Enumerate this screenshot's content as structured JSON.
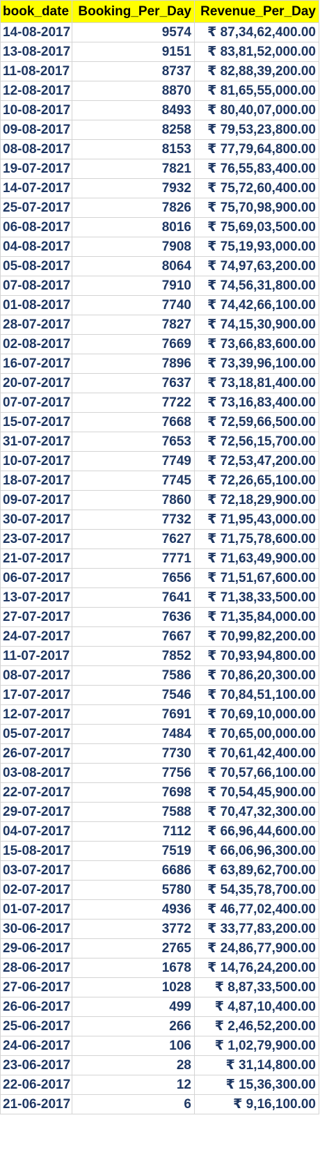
{
  "headers": {
    "date": "book_date",
    "bookings": "Booking_Per_Day",
    "revenue": "Revenue_Per_Day"
  },
  "rows": [
    {
      "date": "14-08-2017",
      "bookings": "9574",
      "revenue": "₹ 87,34,62,400.00"
    },
    {
      "date": "13-08-2017",
      "bookings": "9151",
      "revenue": "₹ 83,81,52,000.00"
    },
    {
      "date": "11-08-2017",
      "bookings": "8737",
      "revenue": "₹ 82,88,39,200.00"
    },
    {
      "date": "12-08-2017",
      "bookings": "8870",
      "revenue": "₹ 81,65,55,000.00"
    },
    {
      "date": "10-08-2017",
      "bookings": "8493",
      "revenue": "₹ 80,40,07,000.00"
    },
    {
      "date": "09-08-2017",
      "bookings": "8258",
      "revenue": "₹ 79,53,23,800.00"
    },
    {
      "date": "08-08-2017",
      "bookings": "8153",
      "revenue": "₹ 77,79,64,800.00"
    },
    {
      "date": "19-07-2017",
      "bookings": "7821",
      "revenue": "₹ 76,55,83,400.00"
    },
    {
      "date": "14-07-2017",
      "bookings": "7932",
      "revenue": "₹ 75,72,60,400.00"
    },
    {
      "date": "25-07-2017",
      "bookings": "7826",
      "revenue": "₹ 75,70,98,900.00"
    },
    {
      "date": "06-08-2017",
      "bookings": "8016",
      "revenue": "₹ 75,69,03,500.00"
    },
    {
      "date": "04-08-2017",
      "bookings": "7908",
      "revenue": "₹ 75,19,93,000.00"
    },
    {
      "date": "05-08-2017",
      "bookings": "8064",
      "revenue": "₹ 74,97,63,200.00"
    },
    {
      "date": "07-08-2017",
      "bookings": "7910",
      "revenue": "₹ 74,56,31,800.00"
    },
    {
      "date": "01-08-2017",
      "bookings": "7740",
      "revenue": "₹ 74,42,66,100.00"
    },
    {
      "date": "28-07-2017",
      "bookings": "7827",
      "revenue": "₹ 74,15,30,900.00"
    },
    {
      "date": "02-08-2017",
      "bookings": "7669",
      "revenue": "₹ 73,66,83,600.00"
    },
    {
      "date": "16-07-2017",
      "bookings": "7896",
      "revenue": "₹ 73,39,96,100.00"
    },
    {
      "date": "20-07-2017",
      "bookings": "7637",
      "revenue": "₹ 73,18,81,400.00"
    },
    {
      "date": "07-07-2017",
      "bookings": "7722",
      "revenue": "₹ 73,16,83,400.00"
    },
    {
      "date": "15-07-2017",
      "bookings": "7668",
      "revenue": "₹ 72,59,66,500.00"
    },
    {
      "date": "31-07-2017",
      "bookings": "7653",
      "revenue": "₹ 72,56,15,700.00"
    },
    {
      "date": "10-07-2017",
      "bookings": "7749",
      "revenue": "₹ 72,53,47,200.00"
    },
    {
      "date": "18-07-2017",
      "bookings": "7745",
      "revenue": "₹ 72,26,65,100.00"
    },
    {
      "date": "09-07-2017",
      "bookings": "7860",
      "revenue": "₹ 72,18,29,900.00"
    },
    {
      "date": "30-07-2017",
      "bookings": "7732",
      "revenue": "₹ 71,95,43,000.00"
    },
    {
      "date": "23-07-2017",
      "bookings": "7627",
      "revenue": "₹ 71,75,78,600.00"
    },
    {
      "date": "21-07-2017",
      "bookings": "7771",
      "revenue": "₹ 71,63,49,900.00"
    },
    {
      "date": "06-07-2017",
      "bookings": "7656",
      "revenue": "₹ 71,51,67,600.00"
    },
    {
      "date": "13-07-2017",
      "bookings": "7641",
      "revenue": "₹ 71,38,33,500.00"
    },
    {
      "date": "27-07-2017",
      "bookings": "7636",
      "revenue": "₹ 71,35,84,000.00"
    },
    {
      "date": "24-07-2017",
      "bookings": "7667",
      "revenue": "₹ 70,99,82,200.00"
    },
    {
      "date": "11-07-2017",
      "bookings": "7852",
      "revenue": "₹ 70,93,94,800.00"
    },
    {
      "date": "08-07-2017",
      "bookings": "7586",
      "revenue": "₹ 70,86,20,300.00"
    },
    {
      "date": "17-07-2017",
      "bookings": "7546",
      "revenue": "₹ 70,84,51,100.00"
    },
    {
      "date": "12-07-2017",
      "bookings": "7691",
      "revenue": "₹ 70,69,10,000.00"
    },
    {
      "date": "05-07-2017",
      "bookings": "7484",
      "revenue": "₹ 70,65,00,000.00"
    },
    {
      "date": "26-07-2017",
      "bookings": "7730",
      "revenue": "₹ 70,61,42,400.00"
    },
    {
      "date": "03-08-2017",
      "bookings": "7756",
      "revenue": "₹ 70,57,66,100.00"
    },
    {
      "date": "22-07-2017",
      "bookings": "7698",
      "revenue": "₹ 70,54,45,900.00"
    },
    {
      "date": "29-07-2017",
      "bookings": "7588",
      "revenue": "₹ 70,47,32,300.00"
    },
    {
      "date": "04-07-2017",
      "bookings": "7112",
      "revenue": "₹ 66,96,44,600.00"
    },
    {
      "date": "15-08-2017",
      "bookings": "7519",
      "revenue": "₹ 66,06,96,300.00"
    },
    {
      "date": "03-07-2017",
      "bookings": "6686",
      "revenue": "₹ 63,89,62,700.00"
    },
    {
      "date": "02-07-2017",
      "bookings": "5780",
      "revenue": "₹ 54,35,78,700.00"
    },
    {
      "date": "01-07-2017",
      "bookings": "4936",
      "revenue": "₹ 46,77,02,400.00"
    },
    {
      "date": "30-06-2017",
      "bookings": "3772",
      "revenue": "₹ 33,77,83,200.00"
    },
    {
      "date": "29-06-2017",
      "bookings": "2765",
      "revenue": "₹ 24,86,77,900.00"
    },
    {
      "date": "28-06-2017",
      "bookings": "1678",
      "revenue": "₹ 14,76,24,200.00"
    },
    {
      "date": "27-06-2017",
      "bookings": "1028",
      "revenue": "₹ 8,87,33,500.00"
    },
    {
      "date": "26-06-2017",
      "bookings": "499",
      "revenue": "₹ 4,87,10,400.00"
    },
    {
      "date": "25-06-2017",
      "bookings": "266",
      "revenue": "₹ 2,46,52,200.00"
    },
    {
      "date": "24-06-2017",
      "bookings": "106",
      "revenue": "₹ 1,02,79,900.00"
    },
    {
      "date": "23-06-2017",
      "bookings": "28",
      "revenue": "₹ 31,14,800.00"
    },
    {
      "date": "22-06-2017",
      "bookings": "12",
      "revenue": "₹ 15,36,300.00"
    },
    {
      "date": "21-06-2017",
      "bookings": "6",
      "revenue": "₹ 9,16,100.00"
    }
  ]
}
